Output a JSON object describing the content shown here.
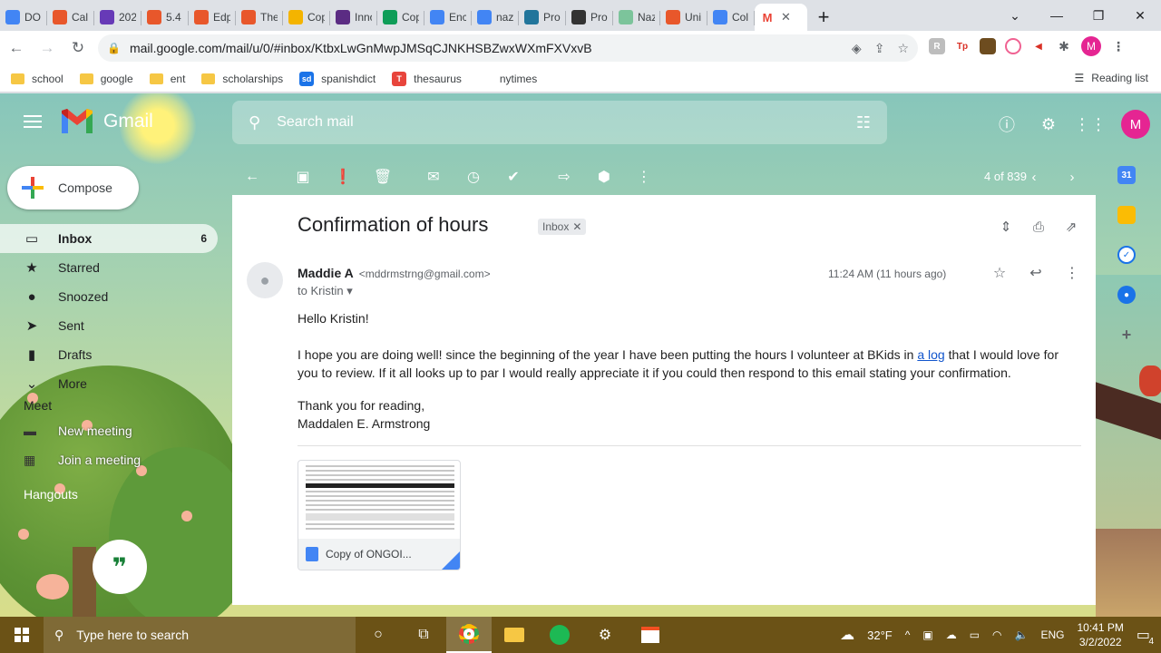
{
  "browser": {
    "tabs": [
      {
        "title": "DO",
        "icon": "docs-icon",
        "color": "#4285f4"
      },
      {
        "title": "Cal",
        "icon": "wheel-icon",
        "color": "#e8572b"
      },
      {
        "title": "202",
        "icon": "forms-icon",
        "color": "#673ab7"
      },
      {
        "title": "5.4",
        "icon": "wheel-icon",
        "color": "#e8572b"
      },
      {
        "title": "Edp",
        "icon": "wheel-icon",
        "color": "#e8572b"
      },
      {
        "title": "The",
        "icon": "wheel-icon",
        "color": "#e8572b"
      },
      {
        "title": "Cop",
        "icon": "slides-icon",
        "color": "#f4b400"
      },
      {
        "title": "Inno",
        "icon": "innovation-icon",
        "color": "#5b2c83"
      },
      {
        "title": "Cop",
        "icon": "sheets-icon",
        "color": "#0f9d58"
      },
      {
        "title": "Enc",
        "icon": "docs-icon",
        "color": "#4285f4"
      },
      {
        "title": "naz",
        "icon": "google-icon",
        "color": "#4285f4"
      },
      {
        "title": "Pro",
        "icon": "wordpress-icon",
        "color": "#21759b"
      },
      {
        "title": "Pro",
        "icon": "wikipedia-icon",
        "color": "#333333"
      },
      {
        "title": "Naz",
        "icon": "naz-icon",
        "color": "#7cc49b"
      },
      {
        "title": "Uni",
        "icon": "wheel-icon",
        "color": "#e8572b"
      },
      {
        "title": "Col",
        "icon": "check-icon",
        "color": "#4285f4"
      }
    ],
    "active_tab": {
      "icon": "gmail-icon",
      "close": "✕"
    },
    "new_tab": "+",
    "url": "mail.google.com/mail/u/0/#inbox/KtbxLwGnMwpJMSqCJNKHSBZwxWXmFXVxvB",
    "profile_initial": "M",
    "bookmarks": [
      {
        "label": "school",
        "type": "folder"
      },
      {
        "label": "google",
        "type": "folder"
      },
      {
        "label": "ent",
        "type": "folder"
      },
      {
        "label": "scholarships",
        "type": "folder"
      },
      {
        "label": "spanishdict",
        "type": "site",
        "badge": "sd",
        "color": "#1a73e8"
      },
      {
        "label": "thesaurus",
        "type": "site",
        "badge": "T",
        "color": "#e8453c"
      },
      {
        "label": "nytimes",
        "type": "site",
        "badge": "",
        "color": "#ffffff"
      }
    ],
    "reading_list": "Reading list"
  },
  "gmail": {
    "logo_text": "Gmail",
    "search_placeholder": "Search mail",
    "account_initial": "M",
    "compose_label": "Compose",
    "nav": [
      {
        "label": "Inbox",
        "count": "6",
        "icon": "inbox-icon",
        "glyph": "▭",
        "active": true
      },
      {
        "label": "Starred",
        "count": "",
        "icon": "star-icon",
        "glyph": "★",
        "active": false
      },
      {
        "label": "Snoozed",
        "count": "",
        "icon": "clock-icon",
        "glyph": "●",
        "active": false
      },
      {
        "label": "Sent",
        "count": "",
        "icon": "send-icon",
        "glyph": "➤",
        "active": false
      },
      {
        "label": "Drafts",
        "count": "",
        "icon": "draft-icon",
        "glyph": "▮",
        "active": false
      },
      {
        "label": "More",
        "count": "",
        "icon": "chevron-down-icon",
        "glyph": "⌄",
        "active": false
      }
    ],
    "meet": {
      "title": "Meet",
      "items": [
        {
          "label": "New meeting",
          "icon": "video-icon",
          "glyph": "▬"
        },
        {
          "label": "Join a meeting",
          "icon": "keyboard-icon",
          "glyph": "▦"
        }
      ]
    },
    "hangouts_title": "Hangouts",
    "pager": {
      "text": "4 of 839"
    },
    "email": {
      "subject": "Confirmation of hours",
      "label": "Inbox",
      "sender_name": "Maddie A",
      "sender_email": "<mddrmstrng@gmail.com>",
      "to": "to Kristin",
      "timestamp": "11:24 AM (11 hours ago)",
      "greeting": "Hello Kristin!",
      "para_before_link": "I hope you are doing well! since the beginning of the year I have been putting the hours I volunteer at BKids in ",
      "link_text": "a log",
      "para_after_link": " that I would love for you to review. If it all looks up to par I would really appreciate it if you could then respond to this email stating your confirmation.",
      "signoff": "Thank you for reading,",
      "signature": "Maddalen E. Armstrong",
      "attachment_name": "Copy of ONGOI..."
    }
  },
  "taskbar": {
    "search_placeholder": "Type here to search",
    "temperature": "32°F",
    "language": "ENG",
    "time": "10:41 PM",
    "date": "3/2/2022",
    "notification_count": "4"
  }
}
